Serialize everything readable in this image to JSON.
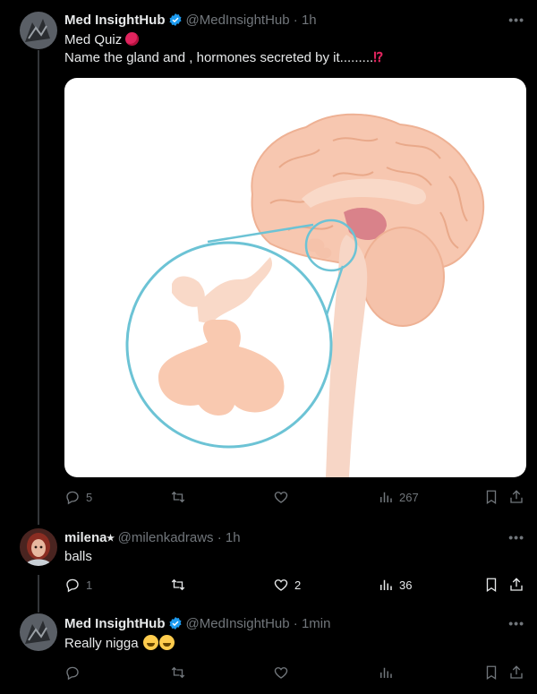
{
  "tweets": [
    {
      "name": "Med InsightHub",
      "handle": "@MedInsightHub",
      "time": "· 1h",
      "line1": "Med Quiz",
      "line2": "Name the gland and , hormones secreted by it.........",
      "line2_suffix": "⁉",
      "replies": "5",
      "retweets": "",
      "likes": "",
      "views": "267"
    },
    {
      "name": "milena⭑",
      "handle": "@milenkadraws",
      "time": "· 1h",
      "text": "balls",
      "replies": "1",
      "retweets": "",
      "likes": "2",
      "views": "36"
    },
    {
      "name": "Med InsightHub",
      "handle": "@MedInsightHub",
      "time": "· 1min",
      "text": "Really nigga",
      "replies": "",
      "retweets": "",
      "likes": "",
      "views": ""
    }
  ],
  "icons": {
    "reply": "reply-icon",
    "retweet": "retweet-icon",
    "like": "heart-icon",
    "views": "views-icon",
    "bookmark": "bookmark-icon",
    "share": "share-icon",
    "more": "more-icon",
    "verified": "verified-badge-icon"
  },
  "colors": {
    "background": "#000000",
    "text": "#e7e9ea",
    "muted": "#71767b",
    "verified": "#1d9bf0",
    "circle": "#6cc3d5"
  }
}
